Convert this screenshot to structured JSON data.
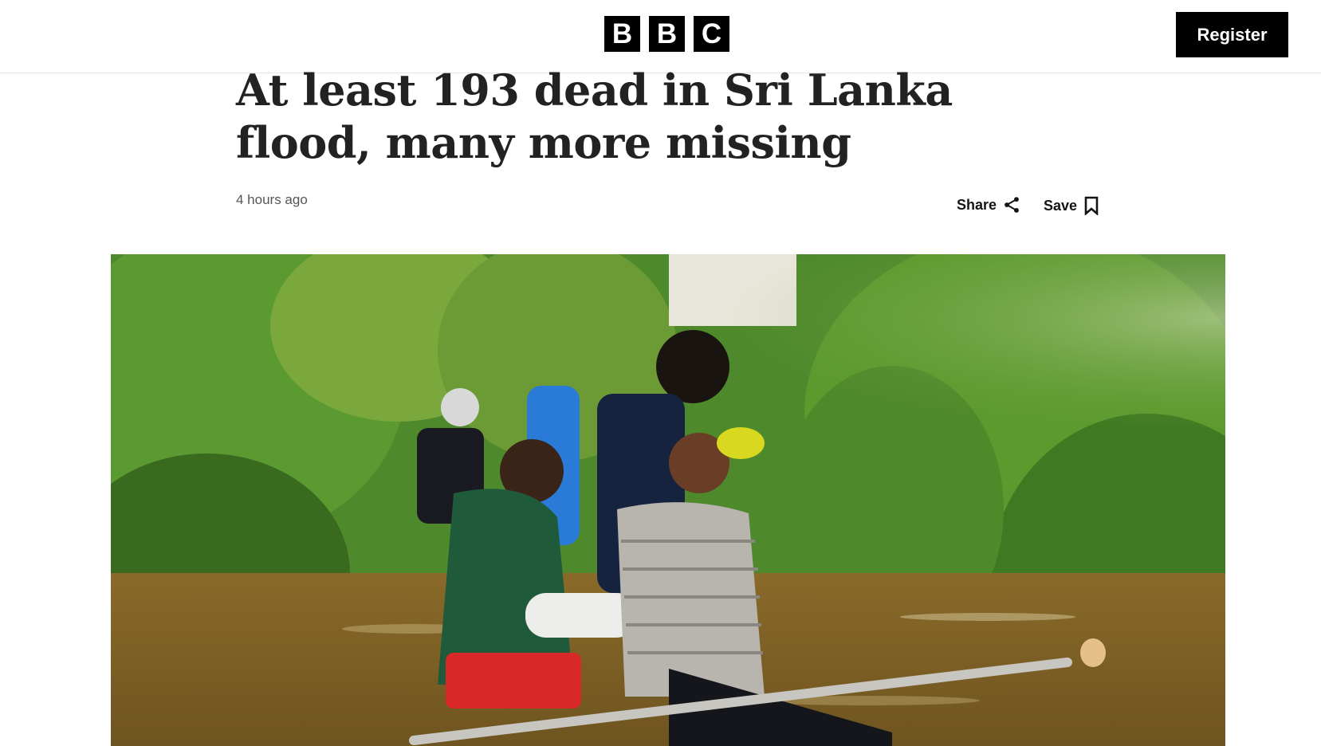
{
  "header": {
    "logo_letters": [
      "B",
      "B",
      "C"
    ],
    "register_label": "Register"
  },
  "article": {
    "headline": "At least 193 dead in Sri Lanka flood, many more missing",
    "timestamp": "4 hours ago",
    "share_label": "Share",
    "save_label": "Save"
  },
  "icons": {
    "share": "share-icon",
    "save": "bookmark-icon"
  }
}
